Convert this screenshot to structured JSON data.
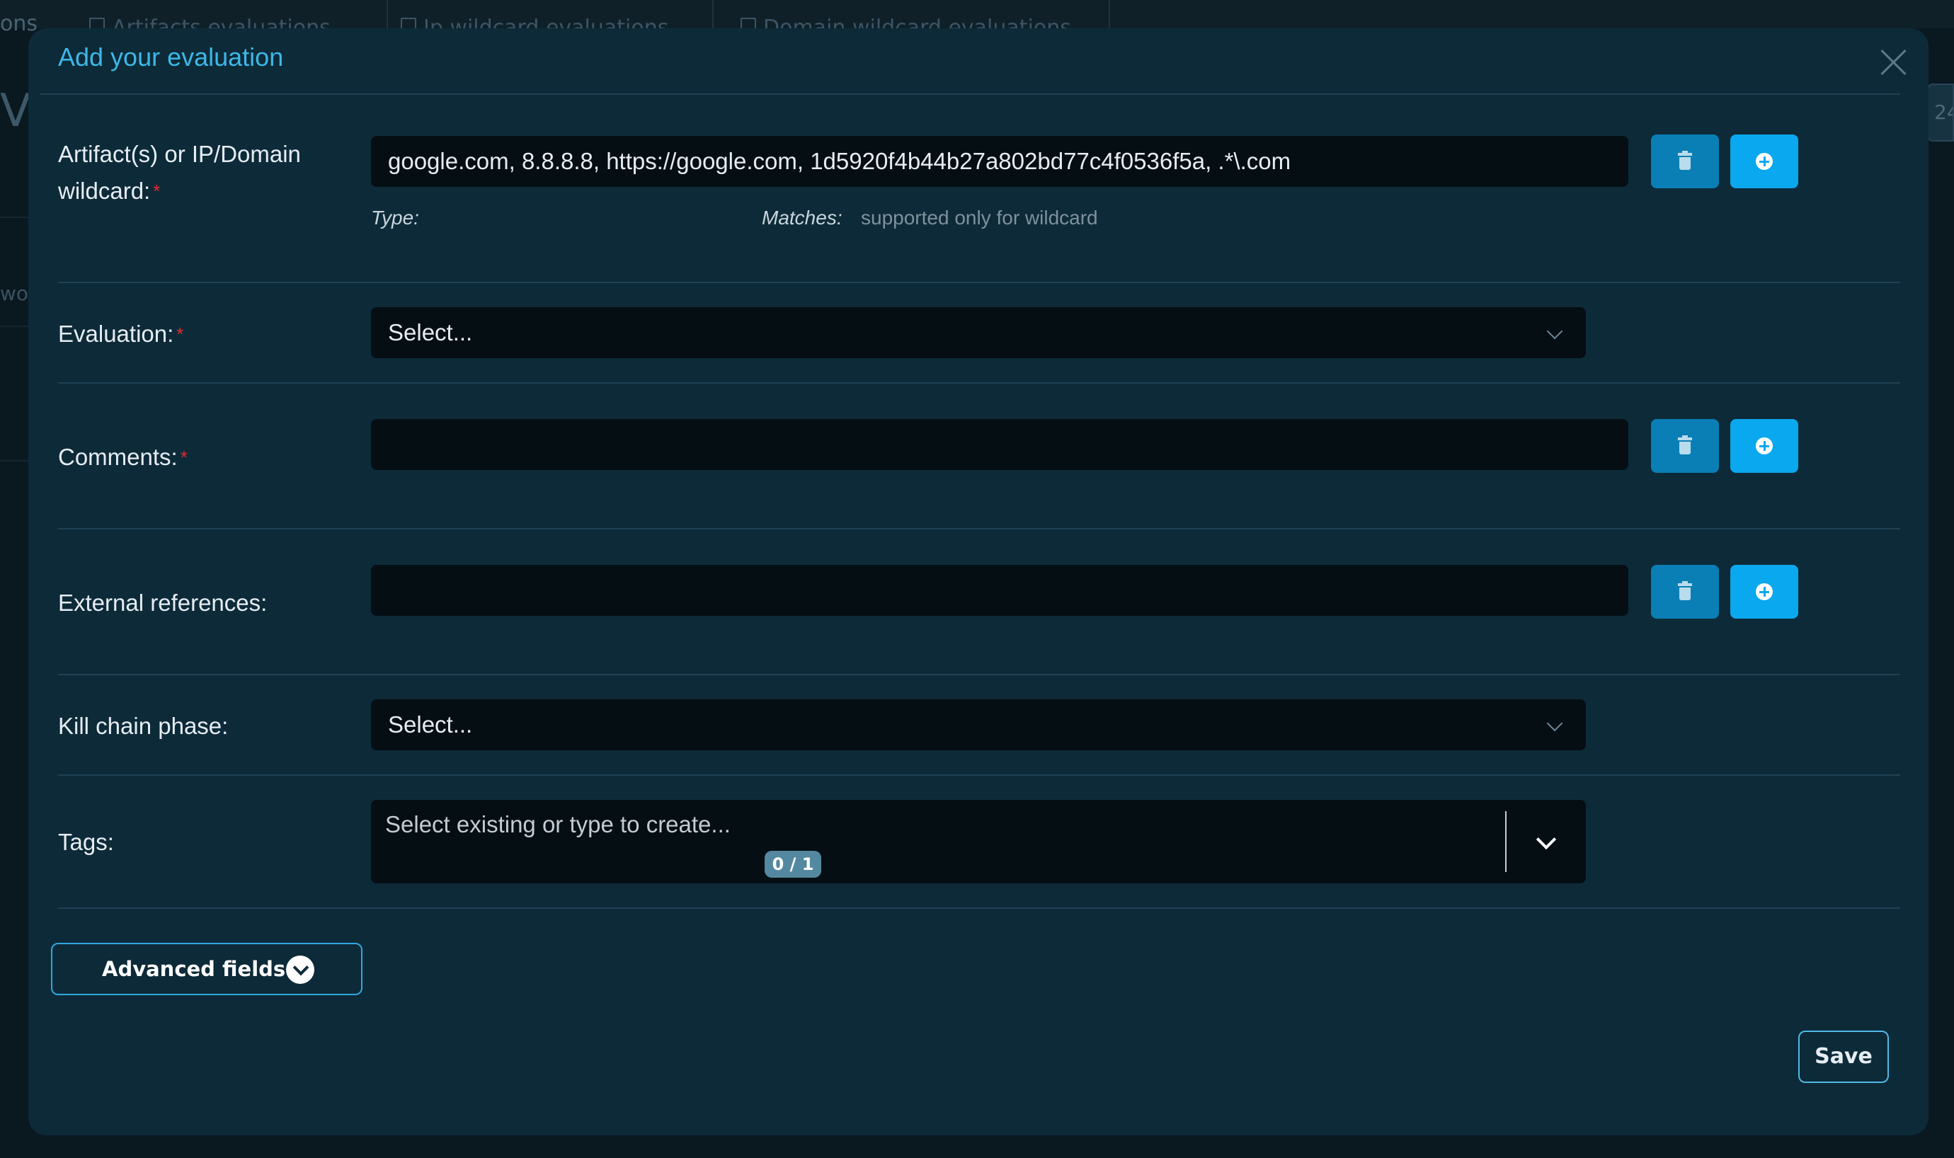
{
  "background": {
    "tabs": [
      "Artifacts evaluations",
      "Ip wildcard evaluations",
      "Domain wildcard evaluations"
    ],
    "left_text": "ons",
    "left_big_letter": "V",
    "left_partial": "wo",
    "right_chip": "24"
  },
  "modal": {
    "title": "Add your evaluation",
    "close_icon": "close-icon"
  },
  "form": {
    "artifact": {
      "label_line1": "Artifact(s) or IP/Domain",
      "label_line2": "wildcard:",
      "required_mark": "*",
      "value": "google.com, 8.8.8.8, https://google.com, 1d5920f4b44b27a802bd77c4f0536f5a, .*\\.com",
      "type_label": "Type:",
      "matches_label": "Matches:",
      "matches_value": "supported only for wildcard"
    },
    "evaluation": {
      "label": "Evaluation:",
      "required_mark": "*",
      "value": "Select..."
    },
    "comments": {
      "label": "Comments:",
      "required_mark": "*",
      "value": ""
    },
    "external_references": {
      "label": "External references:",
      "value": ""
    },
    "kill_chain_phase": {
      "label": "Kill chain phase:",
      "value": "Select..."
    },
    "tags": {
      "label": "Tags:",
      "placeholder": "Select existing or type to create...",
      "counter": "0 / 1"
    }
  },
  "advanced_fields_label": "Advanced fields",
  "save_label": "Save",
  "colors": {
    "modal_bg": "#0d2a39",
    "title": "#3db8e6",
    "trash_button": "#0a7fb5",
    "add_button": "#0aa8ee",
    "required": "#e02b2b"
  }
}
